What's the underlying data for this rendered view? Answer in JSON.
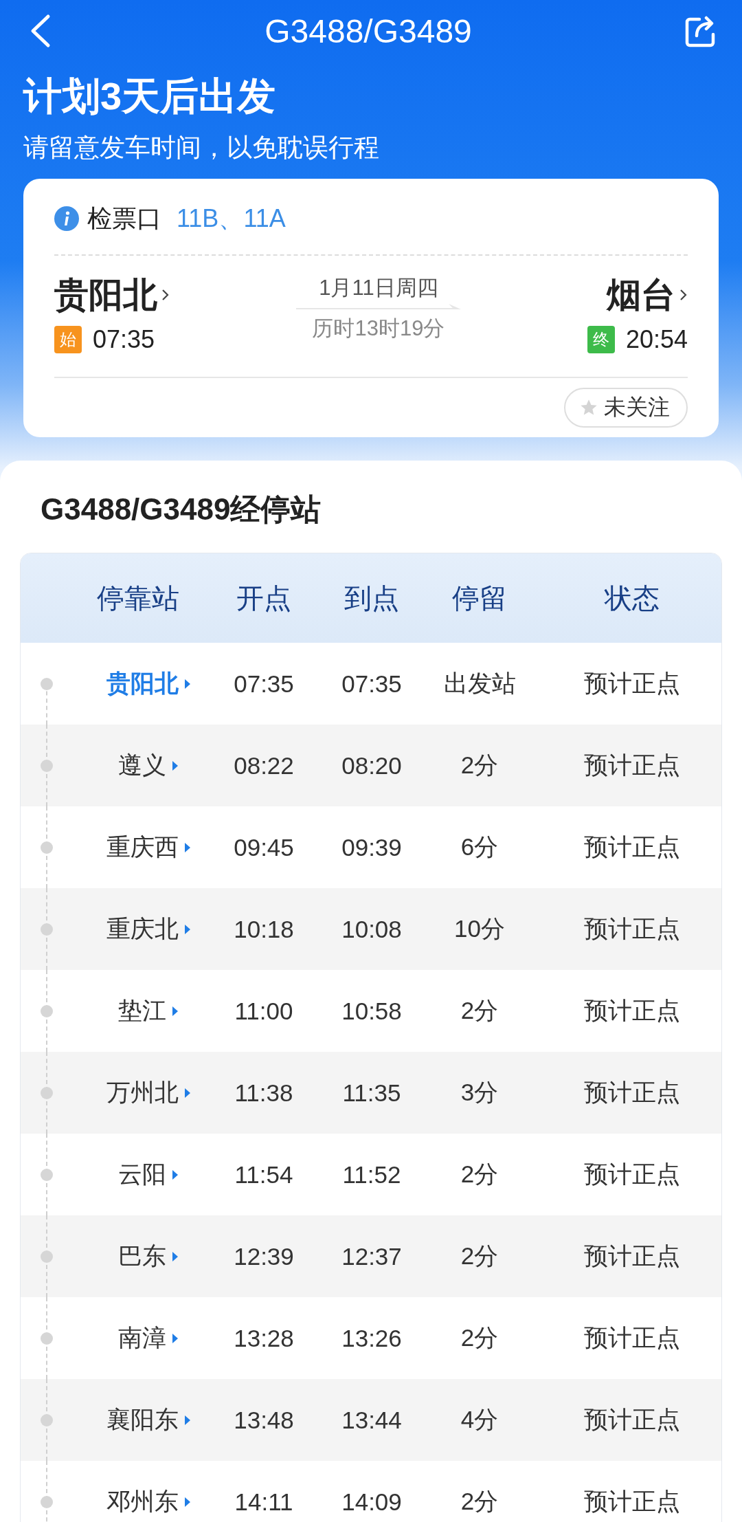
{
  "nav": {
    "title": "G3488/G3489"
  },
  "banner": {
    "heading": "计划3天后出发",
    "subtitle": "请留意发车时间，以免耽误行程"
  },
  "trip": {
    "gate_label": "检票口",
    "gate_value": "11B、11A",
    "origin": {
      "name": "贵阳北",
      "badge": "始",
      "kind": "start",
      "time": "07:35"
    },
    "date": "1月11日周四",
    "duration": "历时13时19分",
    "destination": {
      "name": "烟台",
      "badge": "终",
      "kind": "end",
      "time": "20:54"
    },
    "follow": {
      "label": "未关注",
      "followed": false
    }
  },
  "stops": {
    "title": "G3488/G3489经停站",
    "columns": [
      "停靠站",
      "开点",
      "到点",
      "停留",
      "状态"
    ],
    "rows": [
      {
        "station": "贵阳北",
        "depart": "07:35",
        "arrive": "07:35",
        "stay": "出发站",
        "status": "预计正点",
        "highlighted": true
      },
      {
        "station": "遵义",
        "depart": "08:22",
        "arrive": "08:20",
        "stay": "2分",
        "status": "预计正点",
        "highlighted": false
      },
      {
        "station": "重庆西",
        "depart": "09:45",
        "arrive": "09:39",
        "stay": "6分",
        "status": "预计正点",
        "highlighted": false
      },
      {
        "station": "重庆北",
        "depart": "10:18",
        "arrive": "10:08",
        "stay": "10分",
        "status": "预计正点",
        "highlighted": false
      },
      {
        "station": "垫江",
        "depart": "11:00",
        "arrive": "10:58",
        "stay": "2分",
        "status": "预计正点",
        "highlighted": false
      },
      {
        "station": "万州北",
        "depart": "11:38",
        "arrive": "11:35",
        "stay": "3分",
        "status": "预计正点",
        "highlighted": false
      },
      {
        "station": "云阳",
        "depart": "11:54",
        "arrive": "11:52",
        "stay": "2分",
        "status": "预计正点",
        "highlighted": false
      },
      {
        "station": "巴东",
        "depart": "12:39",
        "arrive": "12:37",
        "stay": "2分",
        "status": "预计正点",
        "highlighted": false
      },
      {
        "station": "南漳",
        "depart": "13:28",
        "arrive": "13:26",
        "stay": "2分",
        "status": "预计正点",
        "highlighted": false
      },
      {
        "station": "襄阳东",
        "depart": "13:48",
        "arrive": "13:44",
        "stay": "4分",
        "status": "预计正点",
        "highlighted": false
      },
      {
        "station": "邓州东",
        "depart": "14:11",
        "arrive": "14:09",
        "stay": "2分",
        "status": "预计正点",
        "highlighted": false
      }
    ]
  }
}
